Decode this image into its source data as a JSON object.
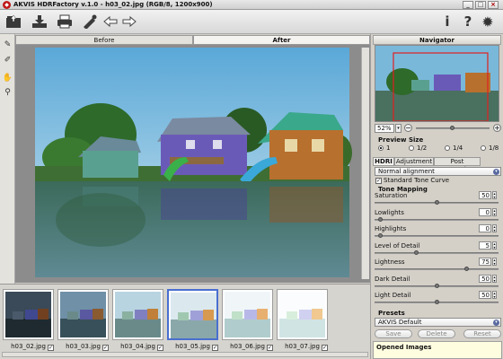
{
  "window": {
    "title": "AKVIS HDRFactory v.1.0 - h03_02.jpg (RGB/8, 1200x900)",
    "min": "_",
    "max": "□",
    "close": "×"
  },
  "toolbar": {
    "icons": [
      "open-icon",
      "save-icon",
      "print-icon",
      "batch-icon",
      "undo-icon",
      "redo-icon",
      "info-icon",
      "help-icon",
      "settings-icon"
    ]
  },
  "tabs": {
    "before": "Before",
    "after": "After"
  },
  "thumbnails": [
    {
      "label": "h03_02.jpg",
      "checked": "✓"
    },
    {
      "label": "h03_03.jpg",
      "checked": "✓"
    },
    {
      "label": "h03_04.jpg",
      "checked": "✓"
    },
    {
      "label": "h03_05.jpg",
      "checked": "✓"
    },
    {
      "label": "h03_06.jpg",
      "checked": "✓"
    },
    {
      "label": "h03_07.jpg",
      "checked": "✓"
    }
  ],
  "navigator": {
    "title": "Navigator",
    "zoom": "52%",
    "minus": "−",
    "plus": "+"
  },
  "preview_size": {
    "title": "Preview Size",
    "options": [
      "1",
      "1/2",
      "1/4",
      "1/8"
    ]
  },
  "panel_tabs": {
    "hdri": "HDRI",
    "adjustment": "Adjustment",
    "post": "Post Processing"
  },
  "alignment": "Normal alignment",
  "standard_tone_curve": "Standard Tone Curve",
  "tone_mapping": {
    "title": "Tone Mapping",
    "sliders": [
      {
        "label": "Saturation",
        "value": "50",
        "pos": 0.5
      },
      {
        "label": "Lowlights",
        "value": "0",
        "pos": 0.03
      },
      {
        "label": "Highlights",
        "value": "0",
        "pos": 0.03
      },
      {
        "label": "Level of Detail",
        "value": "5",
        "pos": 0.33
      },
      {
        "label": "Lightness",
        "value": "75",
        "pos": 0.75
      },
      {
        "label": "Dark Detail",
        "value": "50",
        "pos": 0.5
      },
      {
        "label": "Light Detail",
        "value": "50",
        "pos": 0.5
      }
    ]
  },
  "presets": {
    "title": "Presets",
    "selected": "AKVIS Default",
    "save": "Save",
    "delete": "Delete",
    "reset": "Reset"
  },
  "opened_images": "Opened Images"
}
